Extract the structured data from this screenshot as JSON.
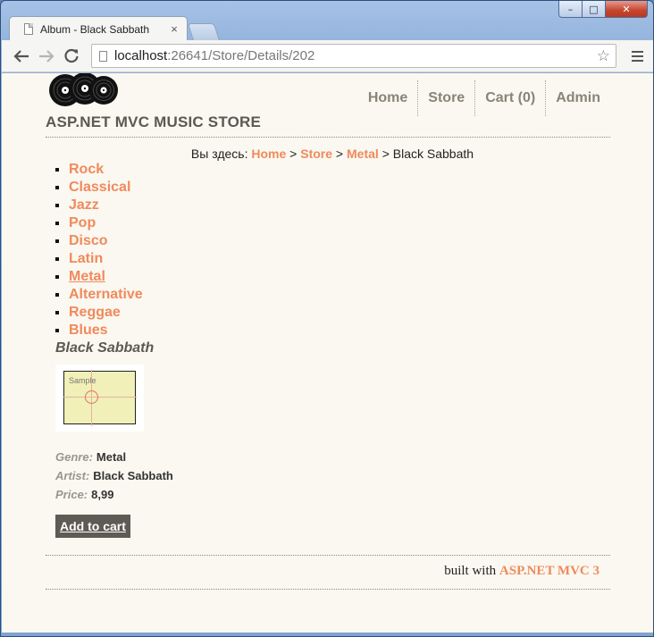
{
  "browser": {
    "tab_title": "Album - Black Sabbath",
    "tab_close": "×",
    "url_host": "localhost",
    "url_rest": ":26641/Store/Details/202",
    "window_controls": {
      "minimize": "–",
      "maximize": "□",
      "close": "✕"
    }
  },
  "site": {
    "title": "ASP.NET MVC MUSIC STORE",
    "nav": [
      {
        "label": "Home"
      },
      {
        "label": "Store"
      },
      {
        "label": "Cart (0)"
      },
      {
        "label": "Admin"
      }
    ]
  },
  "breadcrumb": {
    "prefix": "Вы здесь:",
    "items": [
      "Home",
      "Store",
      "Metal"
    ],
    "separator": ">",
    "current": "Black Sabbath"
  },
  "genres": [
    "Rock",
    "Classical",
    "Jazz",
    "Pop",
    "Disco",
    "Latin",
    "Metal",
    "Alternative",
    "Reggae",
    "Blues"
  ],
  "active_genre": "Metal",
  "album": {
    "title": "Black Sabbath",
    "art_label": "Sample",
    "genre_label": "Genre:",
    "genre": "Metal",
    "artist_label": "Artist:",
    "artist": "Black Sabbath",
    "price_label": "Price:",
    "price": "8,99",
    "add_to_cart": "Add to cart"
  },
  "footer": {
    "prefix": "built with",
    "brand": "ASP.NET MVC 3"
  },
  "colors": {
    "accent": "#f08a5d",
    "page_bg": "#faf8f0",
    "title_gray": "#5a5a52",
    "button_bg": "#5e5a54"
  }
}
